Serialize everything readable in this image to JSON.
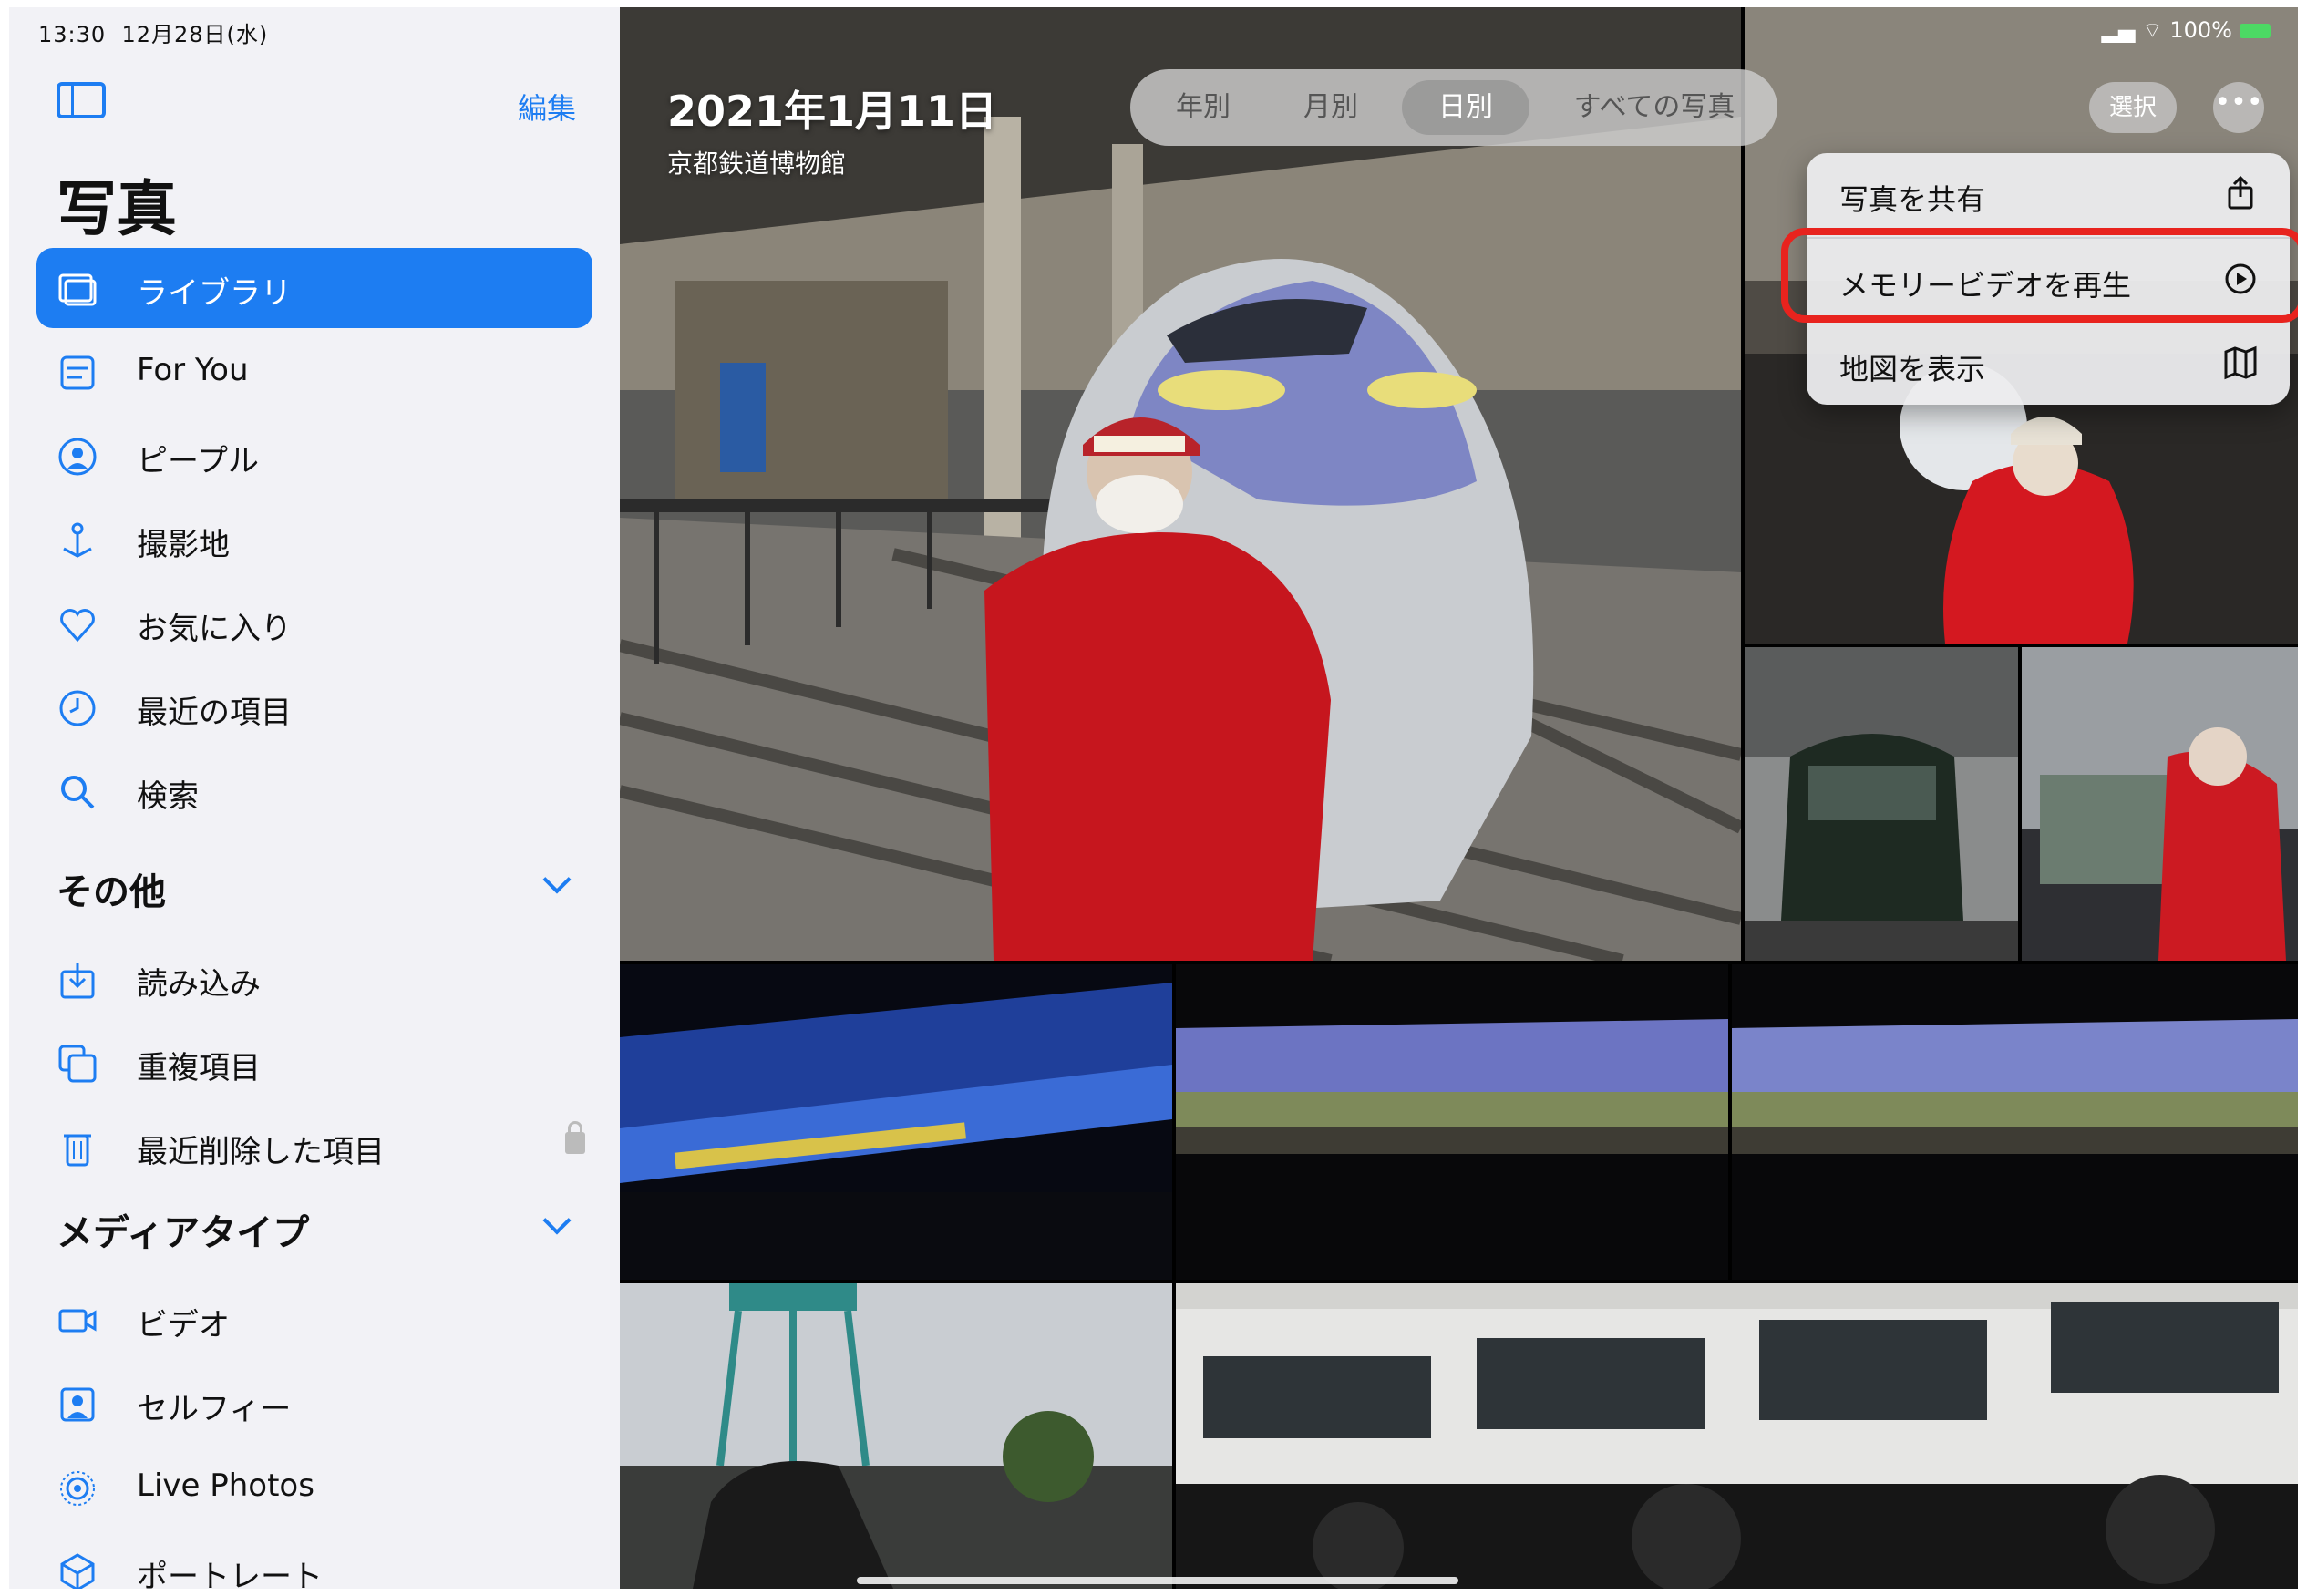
{
  "status_bar": {
    "time": "13:30",
    "date": "12月28日(水)",
    "battery": "100%"
  },
  "sidebar": {
    "edit": "編集",
    "title": "写真",
    "items": [
      {
        "label": "ライブラリ",
        "icon": "library-icon",
        "selected": true
      },
      {
        "label": "For You",
        "icon": "for-you-icon"
      },
      {
        "label": "ピープル",
        "icon": "people-icon"
      },
      {
        "label": "撮影地",
        "icon": "places-icon"
      },
      {
        "label": "お気に入り",
        "icon": "heart-icon"
      },
      {
        "label": "最近の項目",
        "icon": "clock-icon"
      },
      {
        "label": "検索",
        "icon": "search-icon"
      }
    ],
    "section_other": "その他",
    "other_items": [
      {
        "label": "読み込み",
        "icon": "import-icon"
      },
      {
        "label": "重複項目",
        "icon": "duplicates-icon"
      },
      {
        "label": "最近削除した項目",
        "icon": "trash-icon"
      }
    ],
    "section_media": "メディアタイプ",
    "media_items": [
      {
        "label": "ビデオ",
        "icon": "video-icon"
      },
      {
        "label": "セルフィー",
        "icon": "selfie-icon"
      },
      {
        "label": "Live Photos",
        "icon": "live-photos-icon"
      },
      {
        "label": "ポートレート",
        "icon": "portrait-icon"
      }
    ]
  },
  "header": {
    "date": "2021年1月11日",
    "location": "京都鉄道博物館",
    "segments": [
      "年別",
      "月別",
      "日別",
      "すべての写真"
    ],
    "active_segment": "日別",
    "select": "選択",
    "more": "•••"
  },
  "menu": {
    "items": [
      {
        "label": "写真を共有",
        "icon": "share-icon"
      },
      {
        "label": "メモリービデオを再生",
        "icon": "memory-play-icon",
        "highlighted": true
      },
      {
        "label": "地図を表示",
        "icon": "map-icon"
      }
    ]
  },
  "colors": {
    "accent": "#1d7df2",
    "highlight_box": "#e8231e",
    "sidebar_bg": "#f2f2f6"
  }
}
